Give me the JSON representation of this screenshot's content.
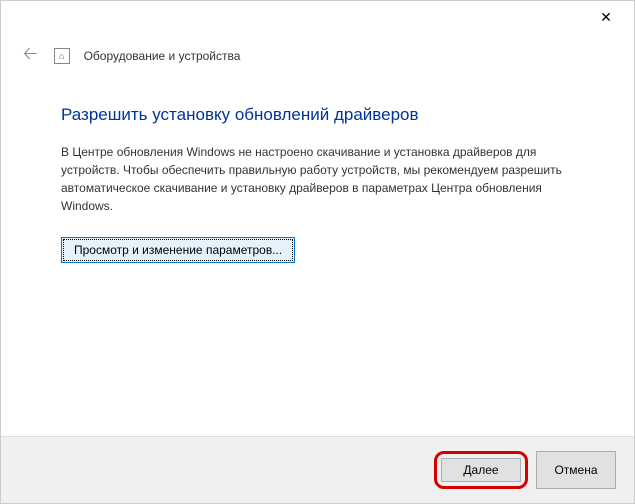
{
  "window": {
    "close_symbol": "✕"
  },
  "header": {
    "back_symbol": "🡠",
    "icon_glyph": "⌂",
    "title": "Оборудование и устройства"
  },
  "content": {
    "heading": "Разрешить установку обновлений драйверов",
    "description": "В Центре обновления Windows не настроено скачивание и установка драйверов для устройств. Чтобы обеспечить правильную работу устройств, мы рекомендуем разрешить автоматическое скачивание и установку драйверов в параметрах Центра обновления Windows.",
    "settings_button": "Просмотр и изменение параметров..."
  },
  "footer": {
    "next": "Далее",
    "cancel": "Отмена"
  }
}
